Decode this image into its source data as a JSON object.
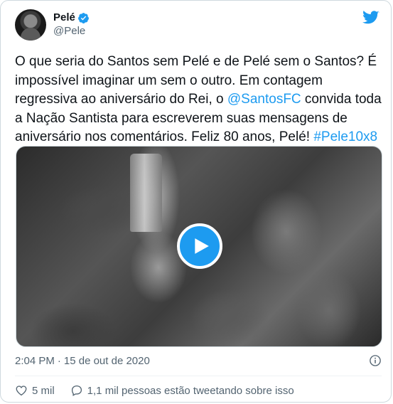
{
  "author": {
    "display_name": "Pelé",
    "handle": "@Pele",
    "verified_icon": "verified-badge-icon",
    "avatar_icon": "avatar"
  },
  "brand": {
    "logo_icon": "twitter-bird-icon",
    "accent_color": "#1d9bf0"
  },
  "tweet": {
    "text_part1": "O que seria do Santos sem Pelé e de Pelé sem o Santos? É impossível imaginar um sem o outro.  Em contagem regressiva ao aniversário do Rei, o ",
    "mention": "@SantosFC",
    "text_part2": " convida toda a Nação Santista para escreverem suas mensagens de aniversário nos comentários. Feliz 80 anos, Pelé! ",
    "hashtag": "#Pele10x8"
  },
  "media": {
    "play_icon": "play-icon"
  },
  "meta": {
    "time": "2:04 PM",
    "separator": "·",
    "date": "15 de out de 2020",
    "info_icon": "info-icon"
  },
  "actions": {
    "likes": "5 mil",
    "conversation": "1,1 mil pessoas estão tweetando sobre isso"
  }
}
